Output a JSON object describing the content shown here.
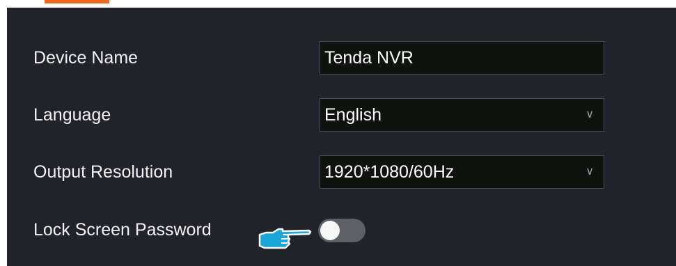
{
  "form": {
    "device_name_label": "Device Name",
    "device_name_value": "Tenda NVR",
    "language_label": "Language",
    "language_value": "English",
    "output_resolution_label": "Output Resolution",
    "output_resolution_value": "1920*1080/60Hz",
    "lock_screen_password_label": "Lock Screen Password",
    "lock_screen_password_enabled": false
  },
  "icons": {
    "chevron": "chevron-down-icon",
    "pointer": "pointing-hand-icon"
  },
  "colors": {
    "panel_bg": "#22232a",
    "accent": "#ef6a20",
    "field_bg": "#101210",
    "toggle_off": "#5f6066",
    "pointer": "#1aa6d6"
  }
}
